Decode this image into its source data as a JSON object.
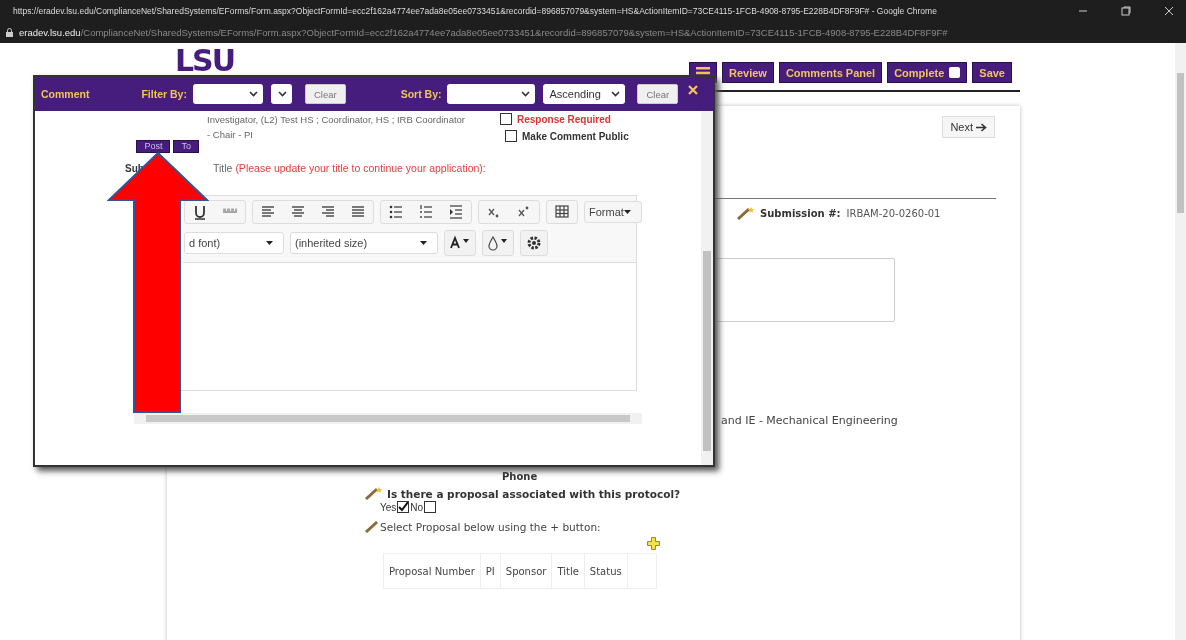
{
  "browser": {
    "title": "https://eradev.lsu.edu/ComplianceNet/SharedSystems/EForms/Form.aspx?ObjectFormId=ecc2f162a4774ee7ada8e05ee0733451&recordid=896857079&system=HS&ActionItemID=73CE4115-1FCB-4908-8795-E228B4DF8F9F# - Google Chrome",
    "domain": "eradev.lsu.edu",
    "path": "/ComplianceNet/SharedSystems/EForms/Form.aspx?ObjectFormId=ecc2f162a4774ee7ada8e05ee0733451&recordid=896857079&system=HS&ActionItemID=73CE4115-1FCB-4908-8795-E228B4DF8F9F#"
  },
  "header": {
    "logo": "LSU",
    "review": "Review",
    "comments_panel": "Comments Panel",
    "complete": {
      "label": "Complete",
      "checked": false
    },
    "save": "Save"
  },
  "form": {
    "next": "Next",
    "submission_label": "Submission #:",
    "submission_value": "IRBAM-20-0260-01",
    "department": "and IE - Mechanical Engineering",
    "phone_label": "Phone",
    "question": "Is there a proposal associated with this protocol?",
    "options": [
      {
        "label": "Yes",
        "checked": true
      },
      {
        "label": "No",
        "checked": false
      }
    ],
    "select_hint": "Select Proposal below using the + button:",
    "table": {
      "columns": [
        "Proposal Number",
        "PI",
        "Sponsor",
        "Title",
        "Status"
      ]
    }
  },
  "comment_panel": {
    "title": "Comment",
    "filter_label": "Filter By:",
    "clear_filter": "Clear",
    "sort_label": "Sort By:",
    "sort_order": "Ascending",
    "clear_sort": "Clear",
    "recipients": "Investigator, (L2) Test HS ; Coordinator, HS ; IRB Coordinator - Chair - PI",
    "post": "Post",
    "to": "To",
    "checkboxes": [
      {
        "label": "Response Required",
        "checked": false,
        "kind": "required"
      },
      {
        "label": "Make Comment Public",
        "checked": false,
        "kind": "public"
      }
    ],
    "subject_label": "Sub",
    "title_label": "Title",
    "title_note": "(Please update your title to continue your application):",
    "editor": {
      "format": "Format",
      "font": "d font)",
      "size": "(inherited size)"
    }
  }
}
